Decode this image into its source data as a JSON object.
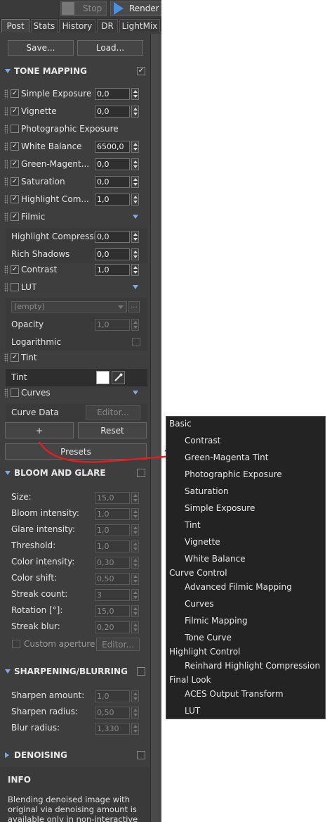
{
  "toolbar": {
    "stop_label": "Stop",
    "render_label": "Render"
  },
  "tabs": [
    "Post",
    "Stats",
    "History",
    "DR",
    "LightMix"
  ],
  "buttons": {
    "save": "Save...",
    "load": "Load..."
  },
  "tone_mapping": {
    "title": "TONE MAPPING",
    "items": [
      {
        "label": "Simple Exposure",
        "value": "0,0",
        "checked": true
      },
      {
        "label": "Vignette",
        "value": "0,0",
        "checked": true
      },
      {
        "label": "Photographic Exposure",
        "value": "",
        "checked": false
      },
      {
        "label": "White Balance",
        "value": "6500,0",
        "checked": true
      },
      {
        "label": "Green-Magent...",
        "value": "0,0",
        "checked": true
      },
      {
        "label": "Saturation",
        "value": "0,0",
        "checked": true
      },
      {
        "label": "Highlight Com...",
        "value": "1,0",
        "checked": true
      }
    ],
    "filmic": {
      "label": "Filmic",
      "checked": true,
      "params": [
        {
          "label": "Highlight Compressi...",
          "value": "0,0"
        },
        {
          "label": "Rich Shadows",
          "value": "0,0"
        }
      ]
    },
    "contrast": {
      "label": "Contrast",
      "value": "1,0",
      "checked": true
    },
    "lut": {
      "label": "LUT",
      "checked": false,
      "dropdown": "(empty)",
      "browse": "...",
      "opacity_label": "Opacity",
      "opacity_value": "1,0",
      "log_label": "Logarithmic"
    },
    "tint": {
      "label": "Tint",
      "checked": true,
      "param_label": "Tint",
      "color": "#ffffff"
    },
    "curves": {
      "label": "Curves",
      "checked": false,
      "data_label": "Curve Data",
      "editor": "Editor...",
      "plus": "+",
      "reset": "Reset"
    },
    "presets": "Presets"
  },
  "bloom": {
    "title": "BLOOM AND GLARE",
    "params": [
      {
        "label": "Size:",
        "value": "15,0"
      },
      {
        "label": "Bloom intensity:",
        "value": "1,0"
      },
      {
        "label": "Glare intensity:",
        "value": "1,0"
      },
      {
        "label": "Threshold:",
        "value": "1,0"
      },
      {
        "label": "Color intensity:",
        "value": "0,30"
      },
      {
        "label": "Color shift:",
        "value": "0,50"
      },
      {
        "label": "Streak count:",
        "value": "3"
      },
      {
        "label": "Rotation [°]:",
        "value": "15,0"
      },
      {
        "label": "Streak blur:",
        "value": "0,20"
      }
    ],
    "custom_aperture": "Custom aperture:",
    "editor": "Editor..."
  },
  "sharpening": {
    "title": "SHARPENING/BLURRING",
    "params": [
      {
        "label": "Sharpen amount:",
        "value": "1,0"
      },
      {
        "label": "Sharpen radius:",
        "value": "0,50"
      },
      {
        "label": "Blur radius:",
        "value": "1,330"
      }
    ]
  },
  "denoising": {
    "title": "DENOISING"
  },
  "info": {
    "title": "INFO",
    "lines": [
      "Blending denoised image with",
      "original via denoising amount is",
      "available only in non-interactive"
    ]
  },
  "popup": {
    "groups": [
      {
        "title": "Basic",
        "items": [
          "Contrast",
          "Green-Magenta Tint",
          "Photographic Exposure",
          "Saturation",
          "Simple Exposure",
          "Tint",
          "Vignette",
          "White Balance"
        ]
      },
      {
        "title": "Curve Control",
        "items": [
          "Advanced Filmic Mapping",
          "Curves",
          "Filmic Mapping",
          "Tone Curve"
        ]
      },
      {
        "title": "Highlight Control",
        "items": [
          "Reinhard Highlight Compression"
        ]
      },
      {
        "title": "Final Look",
        "items": [
          "ACES Output Transform",
          "LUT"
        ]
      }
    ]
  },
  "colors": {
    "panel": "#3e3e3e",
    "accent": "#7aa9e6",
    "arrow": "#e02020"
  }
}
